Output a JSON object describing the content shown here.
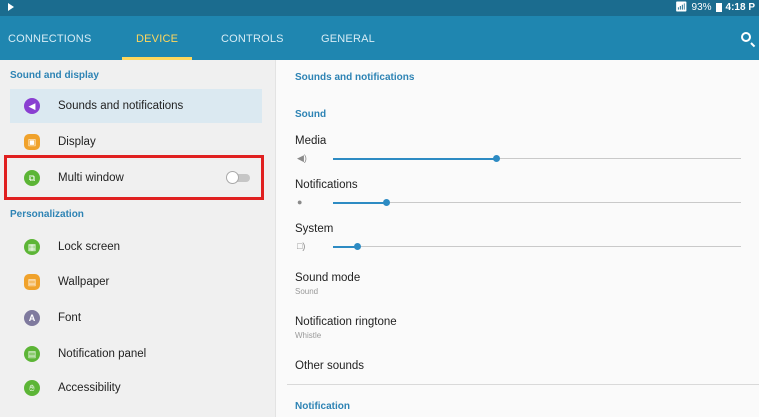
{
  "status_bar": {
    "signal": "93%",
    "time": "4:18 P"
  },
  "tabs": [
    {
      "label": "CONNECTIONS",
      "active": false
    },
    {
      "label": "DEVICE",
      "active": true
    },
    {
      "label": "CONTROLS",
      "active": false
    },
    {
      "label": "GENERAL",
      "active": false
    }
  ],
  "left_panel": {
    "section1": "Sound and display",
    "items1": [
      {
        "label": "Sounds and notifications",
        "icon": "speaker-icon",
        "color": "#8a3fd1",
        "selected": true
      },
      {
        "label": "Display",
        "icon": "display-icon",
        "color": "#f0a22b"
      },
      {
        "label": "Multi window",
        "icon": "multi-window-icon",
        "color": "#5cb536",
        "toggle": false
      }
    ],
    "section2": "Personalization",
    "items2": [
      {
        "label": "Lock screen",
        "icon": "lock-screen-icon",
        "color": "#5cb536"
      },
      {
        "label": "Wallpaper",
        "icon": "wallpaper-icon",
        "color": "#f0a22b"
      },
      {
        "label": "Font",
        "icon": "font-icon",
        "color": "#7f7a9e"
      },
      {
        "label": "Notification panel",
        "icon": "notification-panel-icon",
        "color": "#5cb536"
      },
      {
        "label": "Accessibility",
        "icon": "accessibility-icon",
        "color": "#5cb536"
      }
    ]
  },
  "right_panel": {
    "title": "Sounds and notifications",
    "sound_header": "Sound",
    "sliders": [
      {
        "label": "Media",
        "level": 0.4
      },
      {
        "label": "Notifications",
        "level": 0.13
      },
      {
        "label": "System",
        "level": 0.06
      }
    ],
    "sound_mode": {
      "label": "Sound mode",
      "value": "Sound"
    },
    "ringtone": {
      "label": "Notification ringtone",
      "value": "Whistle"
    },
    "other_sounds": "Other sounds",
    "notification_header": "Notification"
  },
  "colors": {
    "tab_bar": "#1f86b0",
    "status_bar": "#1b6c8f",
    "accent": "#ffd75c",
    "section_text": "#2d83b4",
    "highlight": "#e02020"
  }
}
